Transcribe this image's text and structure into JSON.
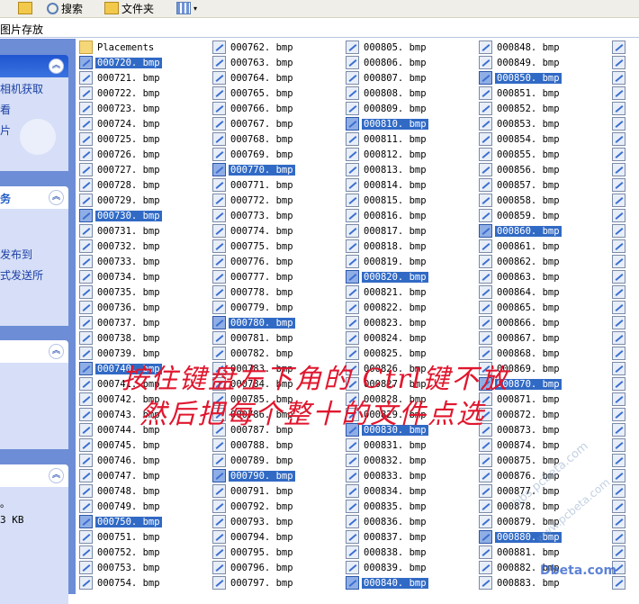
{
  "toolbar": {
    "search_label": "搜索",
    "folders_label": "文件夹"
  },
  "address": {
    "path": "图片存放"
  },
  "sidebar": {
    "picture_tasks": [
      "相机获取",
      "看",
      "片"
    ],
    "file_tasks_title": "务",
    "file_tasks": [
      "发布到",
      "式发送所"
    ],
    "details": [
      "。",
      "3 KB"
    ]
  },
  "files": {
    "col1": [
      "Placements",
      "000720. bmp",
      "000721. bmp",
      "000722. bmp",
      "000723. bmp",
      "000724. bmp",
      "000725. bmp",
      "000726. bmp",
      "000727. bmp",
      "000728. bmp",
      "000729. bmp",
      "000730. bmp",
      "000731. bmp",
      "000732. bmp",
      "000733. bmp",
      "000734. bmp",
      "000735. bmp",
      "000736. bmp",
      "000737. bmp",
      "000738. bmp",
      "000739. bmp",
      "000740. bmp",
      "000741. bmp",
      "000742. bmp",
      "000743. bmp",
      "000744. bmp",
      "000745. bmp",
      "000746. bmp",
      "000747. bmp",
      "000748. bmp",
      "000749. bmp",
      "000750. bmp",
      "000751. bmp",
      "000752. bmp",
      "000753. bmp",
      "000754. bmp"
    ],
    "col2": [
      "000762. bmp",
      "000763. bmp",
      "000764. bmp",
      "000765. bmp",
      "000766. bmp",
      "000767. bmp",
      "000768. bmp",
      "000769. bmp",
      "000770. bmp",
      "000771. bmp",
      "000772. bmp",
      "000773. bmp",
      "000774. bmp",
      "000775. bmp",
      "000776. bmp",
      "000777. bmp",
      "000778. bmp",
      "000779. bmp",
      "000780. bmp",
      "000781. bmp",
      "000782. bmp",
      "000783. bmp",
      "000784. bmp",
      "000785. bmp",
      "000786. bmp",
      "000787. bmp",
      "000788. bmp",
      "000789. bmp",
      "000790. bmp",
      "000791. bmp",
      "000792. bmp",
      "000793. bmp",
      "000794. bmp",
      "000795. bmp",
      "000796. bmp",
      "000797. bmp"
    ],
    "col3": [
      "000805. bmp",
      "000806. bmp",
      "000807. bmp",
      "000808. bmp",
      "000809. bmp",
      "000810. bmp",
      "000811. bmp",
      "000812. bmp",
      "000813. bmp",
      "000814. bmp",
      "000815. bmp",
      "000816. bmp",
      "000817. bmp",
      "000818. bmp",
      "000819. bmp",
      "000820. bmp",
      "000821. bmp",
      "000822. bmp",
      "000823. bmp",
      "000824. bmp",
      "000825. bmp",
      "000826. bmp",
      "000827. bmp",
      "000828. bmp",
      "000829. bmp",
      "000830. bmp",
      "000831. bmp",
      "000832. bmp",
      "000833. bmp",
      "000834. bmp",
      "000835. bmp",
      "000836. bmp",
      "000837. bmp",
      "000838. bmp",
      "000839. bmp",
      "000840. bmp"
    ],
    "col4": [
      "000848. bmp",
      "000849. bmp",
      "000850. bmp",
      "000851. bmp",
      "000852. bmp",
      "000853. bmp",
      "000854. bmp",
      "000855. bmp",
      "000856. bmp",
      "000857. bmp",
      "000858. bmp",
      "000859. bmp",
      "000860. bmp",
      "000861. bmp",
      "000862. bmp",
      "000863. bmp",
      "000864. bmp",
      "000865. bmp",
      "000866. bmp",
      "000867. bmp",
      "000868. bmp",
      "000869. bmp",
      "000870. bmp",
      "000871. bmp",
      "000872. bmp",
      "000873. bmp",
      "000874. bmp",
      "000875. bmp",
      "000876. bmp",
      "000877. bmp",
      "000878. bmp",
      "000879. bmp",
      "000880. bmp",
      "000881. bmp",
      "000882. bmp",
      "000883. bmp"
    ],
    "selected": [
      "000720. bmp",
      "000730. bmp",
      "000740. bmp",
      "000750. bmp",
      "000770. bmp",
      "000780. bmp",
      "000790. bmp",
      "000810. bmp",
      "000820. bmp",
      "000830. bmp",
      "000840. bmp",
      "000850. bmp",
      "000860. bmp",
      "000870. bmp",
      "000880. bmp"
    ]
  },
  "overlay": {
    "line1": "按住键盘左下角的 Ctrl键不放",
    "line2": "然后把每个整十的文件点选"
  },
  "watermarks": [
    "bbs.pcbeta.com",
    "www.pcbeta.com",
    "Dbeta.com"
  ],
  "colors": {
    "selection": "#316ac5",
    "caption": "#e0172e",
    "task_pane": "#6d8dd6"
  }
}
